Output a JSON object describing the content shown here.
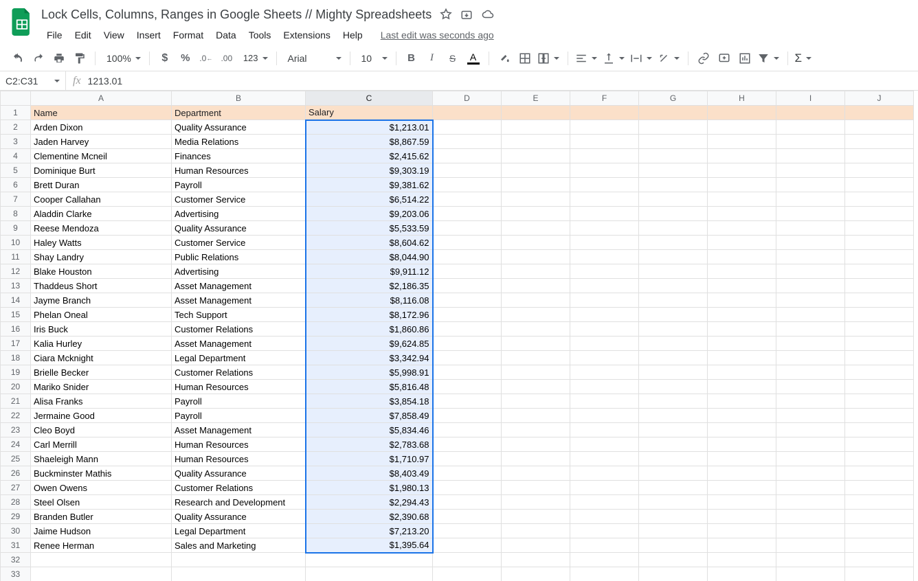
{
  "doc_title": "Lock Cells, Columns, Ranges in Google Sheets // Mighty Spreadsheets",
  "last_edit": "Last edit was seconds ago",
  "menu": [
    "File",
    "Edit",
    "View",
    "Insert",
    "Format",
    "Data",
    "Tools",
    "Extensions",
    "Help"
  ],
  "toolbar": {
    "zoom": "100%",
    "font": "Arial",
    "font_size": "10"
  },
  "namebox": "C2:C31",
  "formula": "1213.01",
  "columns": [
    "A",
    "B",
    "C",
    "D",
    "E",
    "F",
    "G",
    "H",
    "I",
    "J"
  ],
  "header_row": {
    "name": "Name",
    "department": "Department",
    "salary": "Salary"
  },
  "rows": [
    {
      "name": "Arden Dixon",
      "department": "Quality Assurance",
      "salary": "$1,213.01"
    },
    {
      "name": "Jaden Harvey",
      "department": "Media Relations",
      "salary": "$8,867.59"
    },
    {
      "name": "Clementine Mcneil",
      "department": "Finances",
      "salary": "$2,415.62"
    },
    {
      "name": "Dominique Burt",
      "department": "Human Resources",
      "salary": "$9,303.19"
    },
    {
      "name": "Brett Duran",
      "department": "Payroll",
      "salary": "$9,381.62"
    },
    {
      "name": "Cooper Callahan",
      "department": "Customer Service",
      "salary": "$6,514.22"
    },
    {
      "name": "Aladdin Clarke",
      "department": "Advertising",
      "salary": "$9,203.06"
    },
    {
      "name": "Reese Mendoza",
      "department": "Quality Assurance",
      "salary": "$5,533.59"
    },
    {
      "name": "Haley Watts",
      "department": "Customer Service",
      "salary": "$8,604.62"
    },
    {
      "name": "Shay Landry",
      "department": "Public Relations",
      "salary": "$8,044.90"
    },
    {
      "name": "Blake Houston",
      "department": "Advertising",
      "salary": "$9,911.12"
    },
    {
      "name": "Thaddeus Short",
      "department": "Asset Management",
      "salary": "$2,186.35"
    },
    {
      "name": "Jayme Branch",
      "department": "Asset Management",
      "salary": "$8,116.08"
    },
    {
      "name": "Phelan Oneal",
      "department": "Tech Support",
      "salary": "$8,172.96"
    },
    {
      "name": "Iris Buck",
      "department": "Customer Relations",
      "salary": "$1,860.86"
    },
    {
      "name": "Kalia Hurley",
      "department": "Asset Management",
      "salary": "$9,624.85"
    },
    {
      "name": "Ciara Mcknight",
      "department": "Legal Department",
      "salary": "$3,342.94"
    },
    {
      "name": "Brielle Becker",
      "department": "Customer Relations",
      "salary": "$5,998.91"
    },
    {
      "name": "Mariko Snider",
      "department": "Human Resources",
      "salary": "$5,816.48"
    },
    {
      "name": "Alisa Franks",
      "department": "Payroll",
      "salary": "$3,854.18"
    },
    {
      "name": "Jermaine Good",
      "department": "Payroll",
      "salary": "$7,858.49"
    },
    {
      "name": "Cleo Boyd",
      "department": "Asset Management",
      "salary": "$5,834.46"
    },
    {
      "name": "Carl Merrill",
      "department": "Human Resources",
      "salary": "$2,783.68"
    },
    {
      "name": "Shaeleigh Mann",
      "department": "Human Resources",
      "salary": "$1,710.97"
    },
    {
      "name": "Buckminster Mathis",
      "department": "Quality Assurance",
      "salary": "$8,403.49"
    },
    {
      "name": "Owen Owens",
      "department": "Customer Relations",
      "salary": "$1,980.13"
    },
    {
      "name": "Steel Olsen",
      "department": "Research and Development",
      "salary": "$2,294.43"
    },
    {
      "name": "Branden Butler",
      "department": "Quality Assurance",
      "salary": "$2,390.68"
    },
    {
      "name": "Jaime Hudson",
      "department": "Legal Department",
      "salary": "$7,213.20"
    },
    {
      "name": "Renee Herman",
      "department": "Sales and Marketing",
      "salary": "$1,395.64"
    }
  ],
  "empty_rows": 2
}
